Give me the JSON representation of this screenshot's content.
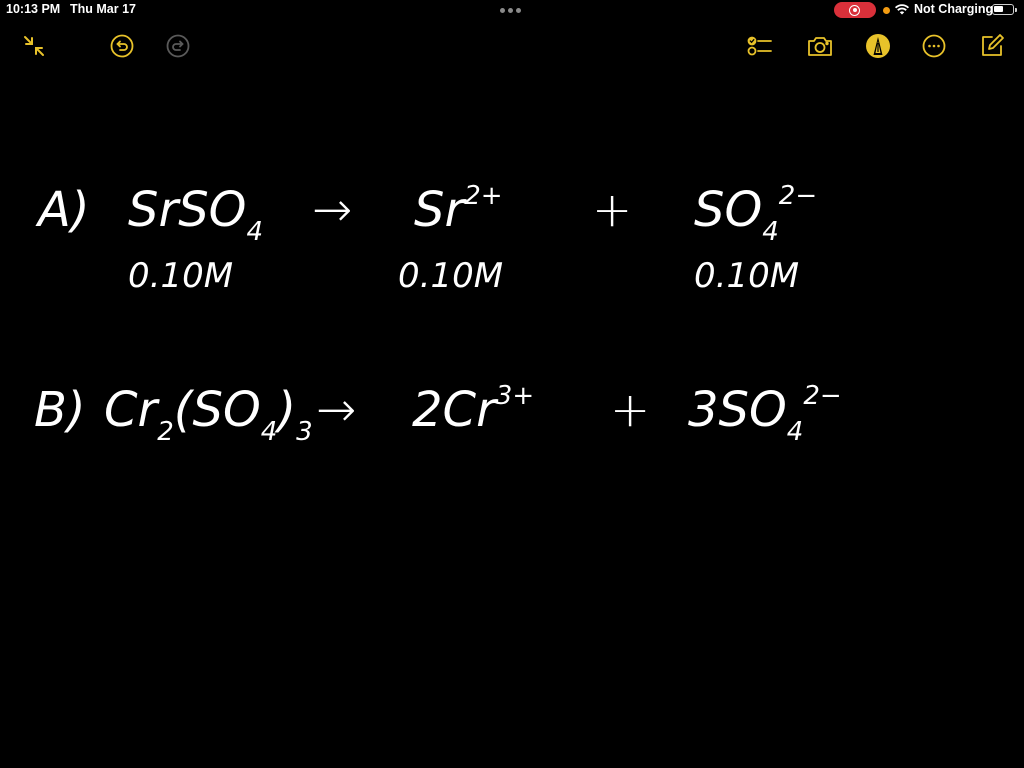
{
  "status_bar": {
    "time": "10:13 PM",
    "date": "Thu Mar 17",
    "charging_status": "Not Charging",
    "colors": {
      "recording": "#d9303a",
      "indicator": "#f39c12"
    }
  },
  "toolbar": {
    "accent_color": "#e8c22a",
    "left_icons": [
      "collapse-icon",
      "undo-icon",
      "redo-icon"
    ],
    "right_icons": [
      "checklist-icon",
      "camera-icon",
      "markup-pen-icon",
      "more-icon",
      "compose-icon"
    ]
  },
  "note": {
    "equation_a": {
      "label": "A)",
      "reactant": {
        "base": "SrSO",
        "sub": "4",
        "conc": "0.10M"
      },
      "arrow": "→",
      "product1": {
        "base": "Sr",
        "sup": "2+",
        "conc": "0.10M"
      },
      "plus": "+",
      "product2": {
        "base": "SO",
        "sub": "4",
        "sup": "2−",
        "conc": "0.10M"
      }
    },
    "equation_b": {
      "label": "B)",
      "reactant": {
        "base1": "Cr",
        "sub1": "2",
        "base2": "(SO",
        "sub2": "4",
        "base3": ")",
        "sub3": "3"
      },
      "arrow": "→",
      "product1": {
        "coef": "2",
        "base": "Cr",
        "sup": "3+"
      },
      "plus": "+",
      "product2": {
        "coef": "3",
        "base": "SO",
        "sub": "4",
        "sup": "2−"
      }
    }
  }
}
